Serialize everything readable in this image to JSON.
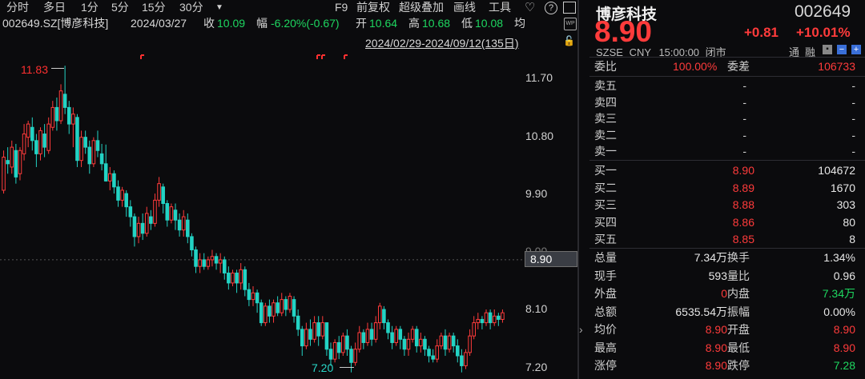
{
  "toolbar": {
    "tabs": [
      "分时",
      "多日",
      "1分",
      "5分",
      "15分",
      "30分"
    ],
    "more_icon": "triangle-down-icon",
    "right_items": [
      "F9",
      "前复权",
      "超级叠加",
      "画线",
      "工具"
    ],
    "icons": [
      "heart-icon",
      "help-icon",
      "window-icon"
    ]
  },
  "info": {
    "code_name": "002649.SZ[博彦科技]",
    "date": "2024/03/27",
    "close_label": "收",
    "close": "10.09",
    "chg_label": "幅",
    "chg": "-6.20%(-0.67)",
    "open_label": "开",
    "open": "10.64",
    "high_label": "高",
    "high": "10.68",
    "low_label": "低",
    "low": "10.08",
    "avg_label": "均"
  },
  "range": "2024/02/29-2024/09/12(135日)",
  "chart_data": {
    "type": "candlestick",
    "title": "",
    "y_ticks": [
      "11.70",
      "10.80",
      "9.90",
      "9.00",
      "8.10",
      "7.20"
    ],
    "ylim": [
      7.1,
      12.05
    ],
    "last_price": "8.90",
    "high_marker": "11.83",
    "low_marker": "7.20",
    "candles": [
      [
        9.95,
        10.45,
        9.9,
        10.55
      ],
      [
        10.4,
        10.35,
        10.2,
        10.6
      ],
      [
        10.3,
        10.6,
        10.2,
        10.7
      ],
      [
        10.55,
        10.15,
        10.05,
        10.65
      ],
      [
        10.2,
        10.55,
        10.1,
        10.6
      ],
      [
        10.5,
        10.8,
        10.4,
        10.95
      ],
      [
        10.75,
        10.95,
        10.6,
        11.0
      ],
      [
        10.9,
        10.7,
        10.55,
        11.05
      ],
      [
        10.7,
        10.5,
        10.3,
        10.8
      ],
      [
        10.5,
        10.85,
        10.4,
        10.9
      ],
      [
        10.8,
        10.6,
        10.45,
        10.95
      ],
      [
        10.55,
        10.95,
        10.5,
        11.05
      ],
      [
        10.9,
        11.2,
        10.85,
        11.3
      ],
      [
        11.2,
        11.0,
        10.85,
        11.35
      ],
      [
        11.0,
        11.45,
        10.95,
        11.55
      ],
      [
        11.4,
        11.2,
        11.1,
        11.83
      ],
      [
        11.2,
        10.95,
        10.8,
        11.3
      ],
      [
        10.95,
        11.1,
        10.6,
        11.2
      ],
      [
        11.05,
        10.4,
        10.3,
        11.1
      ],
      [
        10.4,
        10.75,
        10.3,
        10.85
      ],
      [
        10.75,
        10.6,
        10.5,
        10.85
      ],
      [
        10.6,
        10.35,
        10.2,
        10.7
      ],
      [
        10.35,
        10.7,
        10.3,
        10.75
      ],
      [
        10.7,
        10.55,
        10.45,
        10.85
      ],
      [
        10.5,
        10.35,
        10.25,
        10.65
      ],
      [
        10.35,
        10.09,
        10.08,
        10.64
      ],
      [
        10.09,
        10.2,
        9.95,
        10.3
      ],
      [
        10.2,
        10.0,
        9.9,
        10.25
      ],
      [
        10.0,
        9.8,
        9.7,
        10.1
      ],
      [
        9.8,
        9.95,
        9.7,
        10.0
      ],
      [
        9.9,
        9.7,
        9.55,
        9.95
      ],
      [
        9.7,
        9.55,
        9.4,
        9.8
      ],
      [
        9.55,
        9.25,
        9.1,
        9.6
      ],
      [
        9.25,
        9.45,
        9.15,
        9.55
      ],
      [
        9.45,
        9.3,
        9.2,
        9.6
      ],
      [
        9.3,
        9.6,
        9.25,
        9.7
      ],
      [
        9.55,
        9.45,
        9.35,
        9.65
      ],
      [
        9.45,
        9.8,
        9.4,
        9.9
      ],
      [
        9.8,
        10.05,
        9.7,
        10.15
      ],
      [
        10.0,
        9.75,
        9.6,
        10.05
      ],
      [
        9.75,
        9.5,
        9.4,
        9.8
      ],
      [
        9.5,
        9.7,
        9.45,
        9.75
      ],
      [
        9.65,
        9.5,
        9.35,
        9.75
      ],
      [
        9.5,
        9.35,
        9.25,
        9.6
      ],
      [
        9.35,
        9.55,
        9.25,
        9.65
      ],
      [
        9.5,
        9.25,
        9.15,
        9.6
      ],
      [
        9.25,
        9.05,
        8.95,
        9.3
      ],
      [
        9.05,
        8.8,
        8.7,
        9.1
      ],
      [
        8.8,
        8.9,
        8.7,
        9.0
      ],
      [
        8.9,
        8.8,
        8.75,
        9.0
      ],
      [
        8.8,
        8.9,
        8.75,
        8.95
      ],
      [
        8.9,
        8.95,
        8.8,
        9.05
      ],
      [
        8.95,
        8.85,
        8.75,
        9.0
      ],
      [
        8.85,
        8.9,
        8.7,
        9.0
      ],
      [
        8.9,
        8.7,
        8.6,
        8.95
      ],
      [
        8.7,
        8.55,
        8.45,
        8.8
      ],
      [
        8.55,
        8.7,
        8.5,
        8.75
      ],
      [
        8.7,
        8.55,
        8.4,
        8.75
      ],
      [
        8.55,
        8.75,
        8.45,
        8.85
      ],
      [
        8.75,
        8.45,
        8.35,
        8.8
      ],
      [
        8.45,
        8.3,
        8.2,
        8.55
      ],
      [
        8.3,
        8.4,
        8.2,
        8.5
      ],
      [
        8.4,
        8.25,
        8.1,
        8.45
      ],
      [
        8.25,
        7.95,
        7.9,
        8.3
      ],
      [
        7.95,
        8.2,
        7.9,
        8.25
      ],
      [
        8.2,
        8.05,
        7.95,
        8.3
      ],
      [
        8.05,
        8.25,
        7.95,
        8.3
      ],
      [
        8.25,
        8.1,
        8.05,
        8.35
      ],
      [
        8.1,
        8.3,
        8.05,
        8.4
      ],
      [
        8.3,
        8.15,
        8.05,
        8.35
      ],
      [
        8.15,
        8.35,
        8.1,
        8.4
      ],
      [
        8.3,
        8.05,
        7.95,
        8.35
      ],
      [
        8.05,
        7.85,
        7.75,
        8.15
      ],
      [
        7.85,
        7.6,
        7.45,
        7.9
      ],
      [
        7.6,
        7.85,
        7.55,
        7.95
      ],
      [
        7.85,
        7.7,
        7.6,
        8.0
      ],
      [
        7.7,
        7.95,
        7.65,
        8.05
      ],
      [
        7.95,
        7.75,
        7.6,
        8.05
      ],
      [
        7.75,
        7.95,
        7.7,
        8.05
      ],
      [
        7.95,
        7.55,
        7.45,
        7.95
      ],
      [
        7.55,
        7.4,
        7.3,
        7.65
      ],
      [
        7.4,
        7.65,
        7.35,
        7.7
      ],
      [
        7.65,
        7.5,
        7.4,
        7.75
      ],
      [
        7.5,
        7.75,
        7.45,
        7.8
      ],
      [
        7.75,
        7.55,
        7.45,
        7.85
      ],
      [
        7.55,
        7.35,
        7.2,
        7.6
      ],
      [
        7.35,
        7.55,
        7.3,
        7.65
      ],
      [
        7.55,
        7.8,
        7.5,
        7.9
      ],
      [
        7.8,
        7.65,
        7.55,
        7.85
      ],
      [
        7.65,
        7.85,
        7.6,
        7.95
      ],
      [
        7.85,
        7.7,
        7.6,
        7.95
      ],
      [
        7.7,
        7.95,
        7.65,
        8.05
      ],
      [
        7.95,
        8.2,
        7.85,
        8.25
      ],
      [
        8.15,
        7.95,
        7.85,
        8.2
      ],
      [
        7.95,
        7.8,
        7.7,
        8.0
      ],
      [
        7.8,
        7.65,
        7.55,
        7.9
      ],
      [
        7.65,
        7.85,
        7.6,
        7.9
      ],
      [
        7.85,
        7.7,
        7.55,
        7.9
      ],
      [
        7.7,
        7.55,
        7.45,
        7.75
      ],
      [
        7.55,
        7.7,
        7.45,
        7.8
      ],
      [
        7.7,
        7.85,
        7.65,
        7.9
      ],
      [
        7.85,
        7.6,
        7.5,
        7.9
      ],
      [
        7.6,
        7.7,
        7.5,
        7.8
      ],
      [
        7.7,
        7.55,
        7.45,
        7.75
      ],
      [
        7.55,
        7.45,
        7.35,
        7.6
      ],
      [
        7.45,
        7.4,
        7.35,
        7.55
      ],
      [
        7.4,
        7.6,
        7.35,
        7.7
      ],
      [
        7.6,
        7.75,
        7.55,
        7.8
      ],
      [
        7.75,
        7.55,
        7.45,
        7.85
      ],
      [
        7.55,
        7.75,
        7.5,
        7.8
      ],
      [
        7.75,
        7.6,
        7.5,
        7.8
      ],
      [
        7.6,
        7.45,
        7.35,
        7.7
      ],
      [
        7.45,
        7.3,
        7.2,
        7.55
      ],
      [
        7.3,
        7.5,
        7.25,
        7.55
      ],
      [
        7.5,
        7.75,
        7.45,
        7.85
      ],
      [
        7.75,
        7.95,
        7.7,
        8.05
      ],
      [
        7.95,
        8.0,
        7.85,
        8.1
      ],
      [
        8.0,
        7.95,
        7.85,
        8.05
      ],
      [
        7.95,
        8.1,
        7.9,
        8.15
      ],
      [
        8.1,
        7.95,
        7.85,
        8.15
      ],
      [
        7.95,
        8.05,
        7.9,
        8.15
      ],
      [
        8.05,
        8.0,
        7.9,
        8.1
      ],
      [
        8.0,
        8.1,
        7.95,
        8.15
      ]
    ]
  },
  "quote": {
    "name": "博彦科技",
    "code": "002649",
    "price": "8.90",
    "change": "+0.81",
    "pct": "+10.01%",
    "market": "SZSE",
    "currency": "CNY",
    "time": "15:00:00",
    "status": "闭市",
    "tag1": "通",
    "tag2": "融",
    "ratio_label": "委比",
    "ratio": "100.00%",
    "diff_label": "委差",
    "diff": "106733"
  },
  "sell": [
    {
      "label": "卖五",
      "price": "-",
      "vol": "-"
    },
    {
      "label": "卖四",
      "price": "-",
      "vol": "-"
    },
    {
      "label": "卖三",
      "price": "-",
      "vol": "-"
    },
    {
      "label": "卖二",
      "price": "-",
      "vol": "-"
    },
    {
      "label": "卖一",
      "price": "-",
      "vol": "-"
    }
  ],
  "buy": [
    {
      "label": "买一",
      "price": "8.90",
      "vol": "104672"
    },
    {
      "label": "买二",
      "price": "8.89",
      "vol": "1670"
    },
    {
      "label": "买三",
      "price": "8.88",
      "vol": "303"
    },
    {
      "label": "买四",
      "price": "8.86",
      "vol": "80"
    },
    {
      "label": "买五",
      "price": "8.85",
      "vol": "8"
    }
  ],
  "stats": [
    {
      "l1": "总量",
      "v1": "7.34万",
      "c1": "white",
      "l2": "换手",
      "v2": "1.34%",
      "c2": "white"
    },
    {
      "l1": "现手",
      "v1": "593",
      "c1": "white",
      "l2": "量比",
      "v2": "0.96",
      "c2": "white"
    },
    {
      "l1": "外盘",
      "v1": "0",
      "c1": "red",
      "l2": "内盘",
      "v2": "7.34万",
      "c2": "green"
    },
    {
      "l1": "总额",
      "v1": "6535.54万",
      "c1": "white",
      "l2": "振幅",
      "v2": "0.00%",
      "c2": "white"
    },
    {
      "l1": "均价",
      "v1": "8.90",
      "c1": "red",
      "l2": "开盘",
      "v2": "8.90",
      "c2": "red"
    },
    {
      "l1": "最高",
      "v1": "8.90",
      "c1": "red",
      "l2": "最低",
      "v2": "8.90",
      "c2": "red"
    },
    {
      "l1": "涨停",
      "v1": "8.90",
      "c1": "red",
      "l2": "跌停",
      "v2": "7.28",
      "c2": "green"
    }
  ],
  "colors": {
    "up": "#ff3b3b",
    "down": "#23d3c4",
    "bg": "#0b0b0d"
  }
}
